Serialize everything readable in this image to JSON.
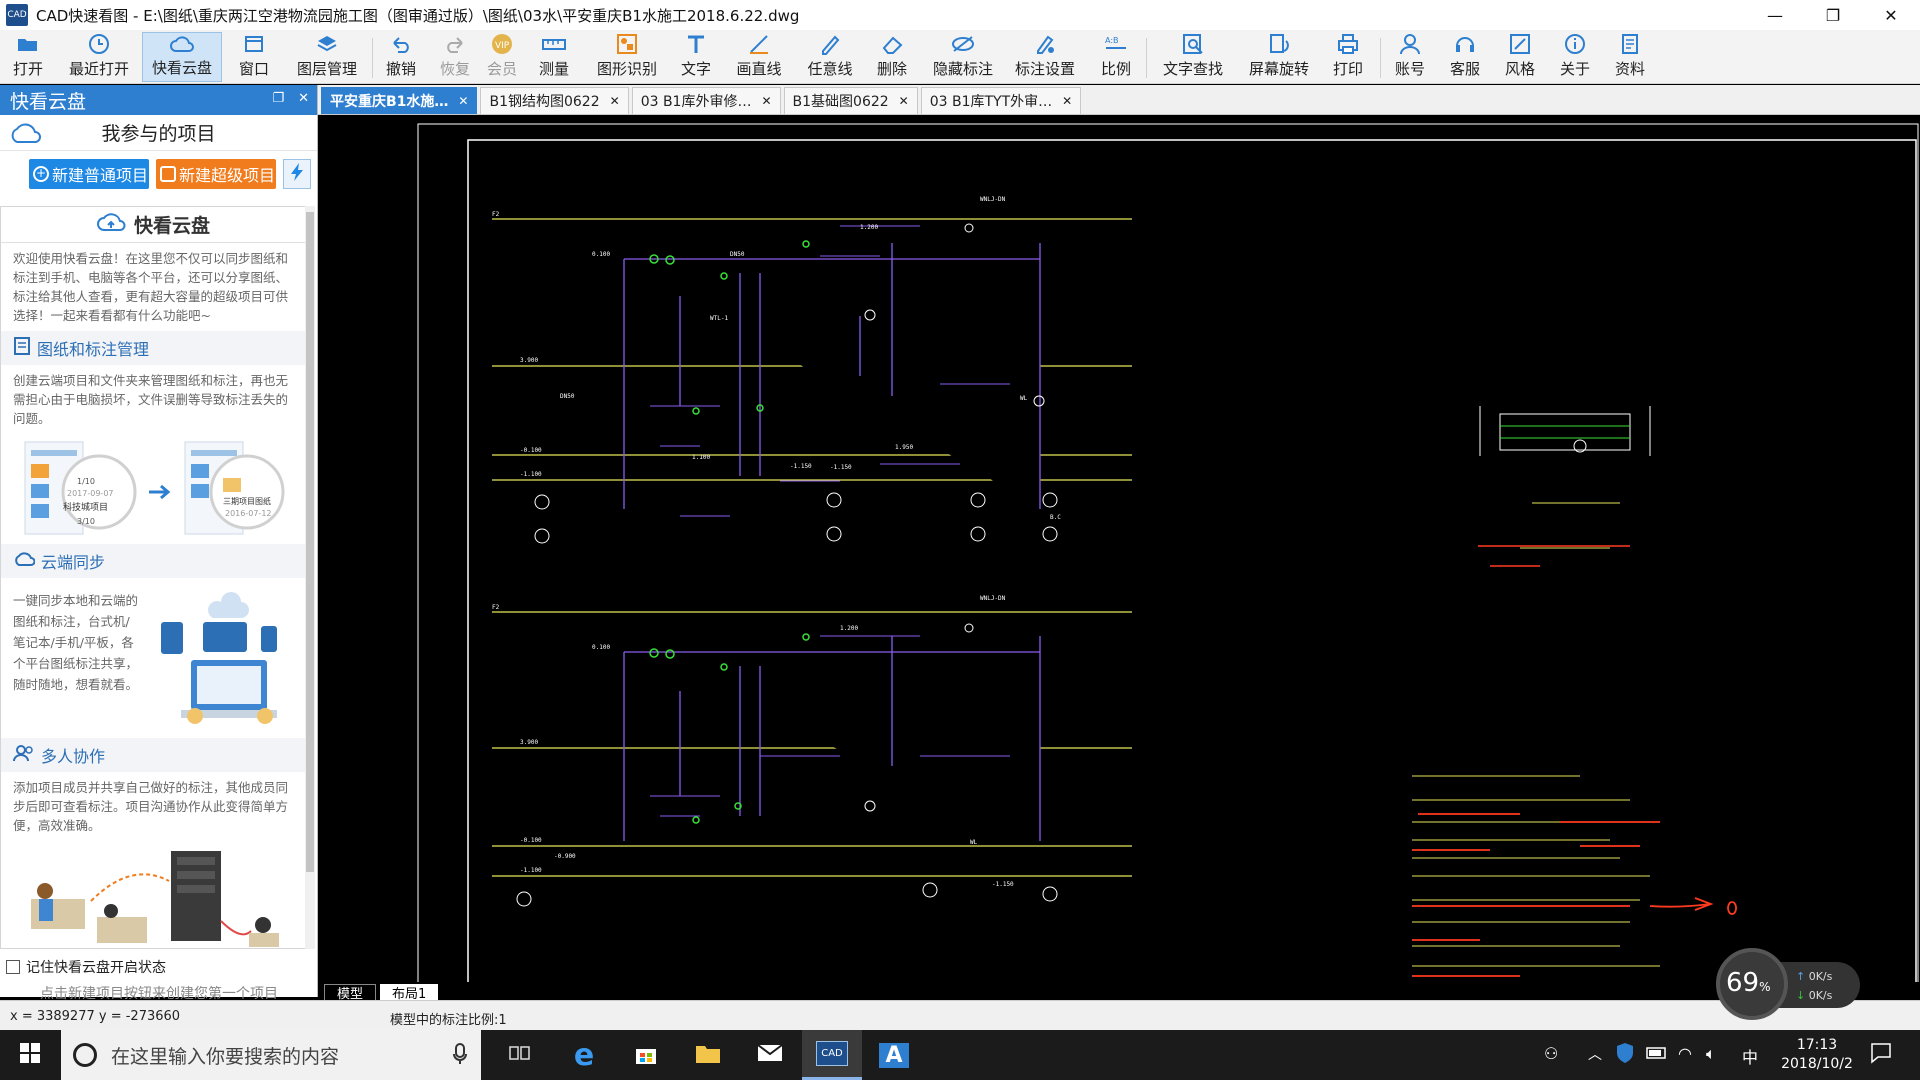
{
  "window": {
    "title": "CAD快速看图 - E:\\图纸\\重庆两江空港物流园施工图（图审通过版）\\图纸\\03水\\平安重庆B1水施工2018.6.22.dwg",
    "app_icon_text": "CAD",
    "minimize": "—",
    "maximize": "❐",
    "close": "✕"
  },
  "toolbar": {
    "items": [
      {
        "label": "打开",
        "icon": "folder-open-icon"
      },
      {
        "label": "最近打开",
        "icon": "clock-icon"
      },
      {
        "label": "快看云盘",
        "icon": "cloud-icon",
        "active": true
      },
      {
        "label": "窗口",
        "icon": "window-icon"
      },
      {
        "label": "图层管理",
        "icon": "layers-icon"
      },
      {
        "label": "撤销",
        "icon": "undo-icon"
      },
      {
        "label": "恢复",
        "icon": "redo-icon",
        "disabled": true
      },
      {
        "label": "会员",
        "icon": "vip-icon",
        "disabled": true
      },
      {
        "label": "测量",
        "icon": "ruler-icon"
      },
      {
        "label": "图形识别",
        "icon": "shape-recognize-icon"
      },
      {
        "label": "文字",
        "icon": "text-icon"
      },
      {
        "label": "画直线",
        "icon": "line-icon"
      },
      {
        "label": "任意线",
        "icon": "pen-icon"
      },
      {
        "label": "删除",
        "icon": "eraser-icon"
      },
      {
        "label": "隐藏标注",
        "icon": "eye-hidden-icon"
      },
      {
        "label": "标注设置",
        "icon": "annotation-settings-icon"
      },
      {
        "label": "比例",
        "icon": "scale-icon"
      },
      {
        "label": "文字查找",
        "icon": "text-search-icon"
      },
      {
        "label": "屏幕旋转",
        "icon": "rotate-icon"
      },
      {
        "label": "打印",
        "icon": "printer-icon"
      },
      {
        "label": "账号",
        "icon": "user-icon"
      },
      {
        "label": "客服",
        "icon": "headset-icon"
      },
      {
        "label": "风格",
        "icon": "style-icon"
      },
      {
        "label": "关于",
        "icon": "info-icon"
      },
      {
        "label": "资料",
        "icon": "documents-icon"
      }
    ]
  },
  "sidebar": {
    "title": "快看云盘",
    "project_header": "我参与的项目",
    "new_normal": "新建普通项目",
    "new_super": "新建超级项目",
    "panel_title": "快看云盘",
    "intro": "欢迎使用快看云盘！在这里您不仅可以同步图纸和标注到手机、电脑等各个平台，还可以分享图纸、标注给其他人查看，更有超大容量的超级项目可供选择！一起来看看都有什么功能吧~",
    "sections": [
      {
        "title": "图纸和标注管理",
        "icon": "document-icon",
        "text": "创建云端项目和文件夹来管理图纸和标注，再也无需担心由于电脑损坏，文件误删等导致标注丢失的问题。"
      },
      {
        "title": "云端同步",
        "icon": "cloud-sync-icon",
        "text": "一键同步本地和云端的图纸和标注，台式机/笔记本/手机/平板，各个平台图纸标注共享，随时随地，想看就看。"
      },
      {
        "title": "多人协作",
        "icon": "people-icon",
        "text": "添加项目成员并共享自己做好的标注，其他成员同步后即可查看标注。项目沟通协作从此变得简单方便，高效准确。"
      }
    ],
    "illus_items": [
      "科技城项目",
      "三期项目图纸"
    ],
    "illus_dates": [
      "2017-09-07",
      "2016-07-12"
    ],
    "illus_counts": [
      "1/10",
      "3/10"
    ],
    "remember_label": "记住快看云盘开启状态",
    "hint": "点击新建项目按钮来创建您第一个项目"
  },
  "tabs": [
    {
      "label": "平安重庆B1水施…",
      "active": true
    },
    {
      "label": "B1钢结构图0622"
    },
    {
      "label": "03 B1库外审修…"
    },
    {
      "label": "B1基础图0622"
    },
    {
      "label": "03 B1库TYT外审…"
    }
  ],
  "layout_tabs": [
    {
      "label": "模型",
      "active": true
    },
    {
      "label": "布局1"
    }
  ],
  "status": {
    "coords": "x = 3389277 y = -273660",
    "scale": "模型中的标注比例:1"
  },
  "speed_widget": {
    "percent": "69",
    "unit": "%",
    "up": "0K/s",
    "down": "0K/s"
  },
  "taskbar": {
    "search_placeholder": "在这里输入你要搜索的内容",
    "ime": "中",
    "time": "17:13",
    "date": "2018/10/2"
  },
  "colors": {
    "accent": "#2f7fd0",
    "orange": "#f07c1d",
    "cad_yellow": "#e6e65a",
    "cad_purple": "#8a5cf0",
    "cad_green": "#38e038",
    "cad_red": "#ff3a1f"
  }
}
